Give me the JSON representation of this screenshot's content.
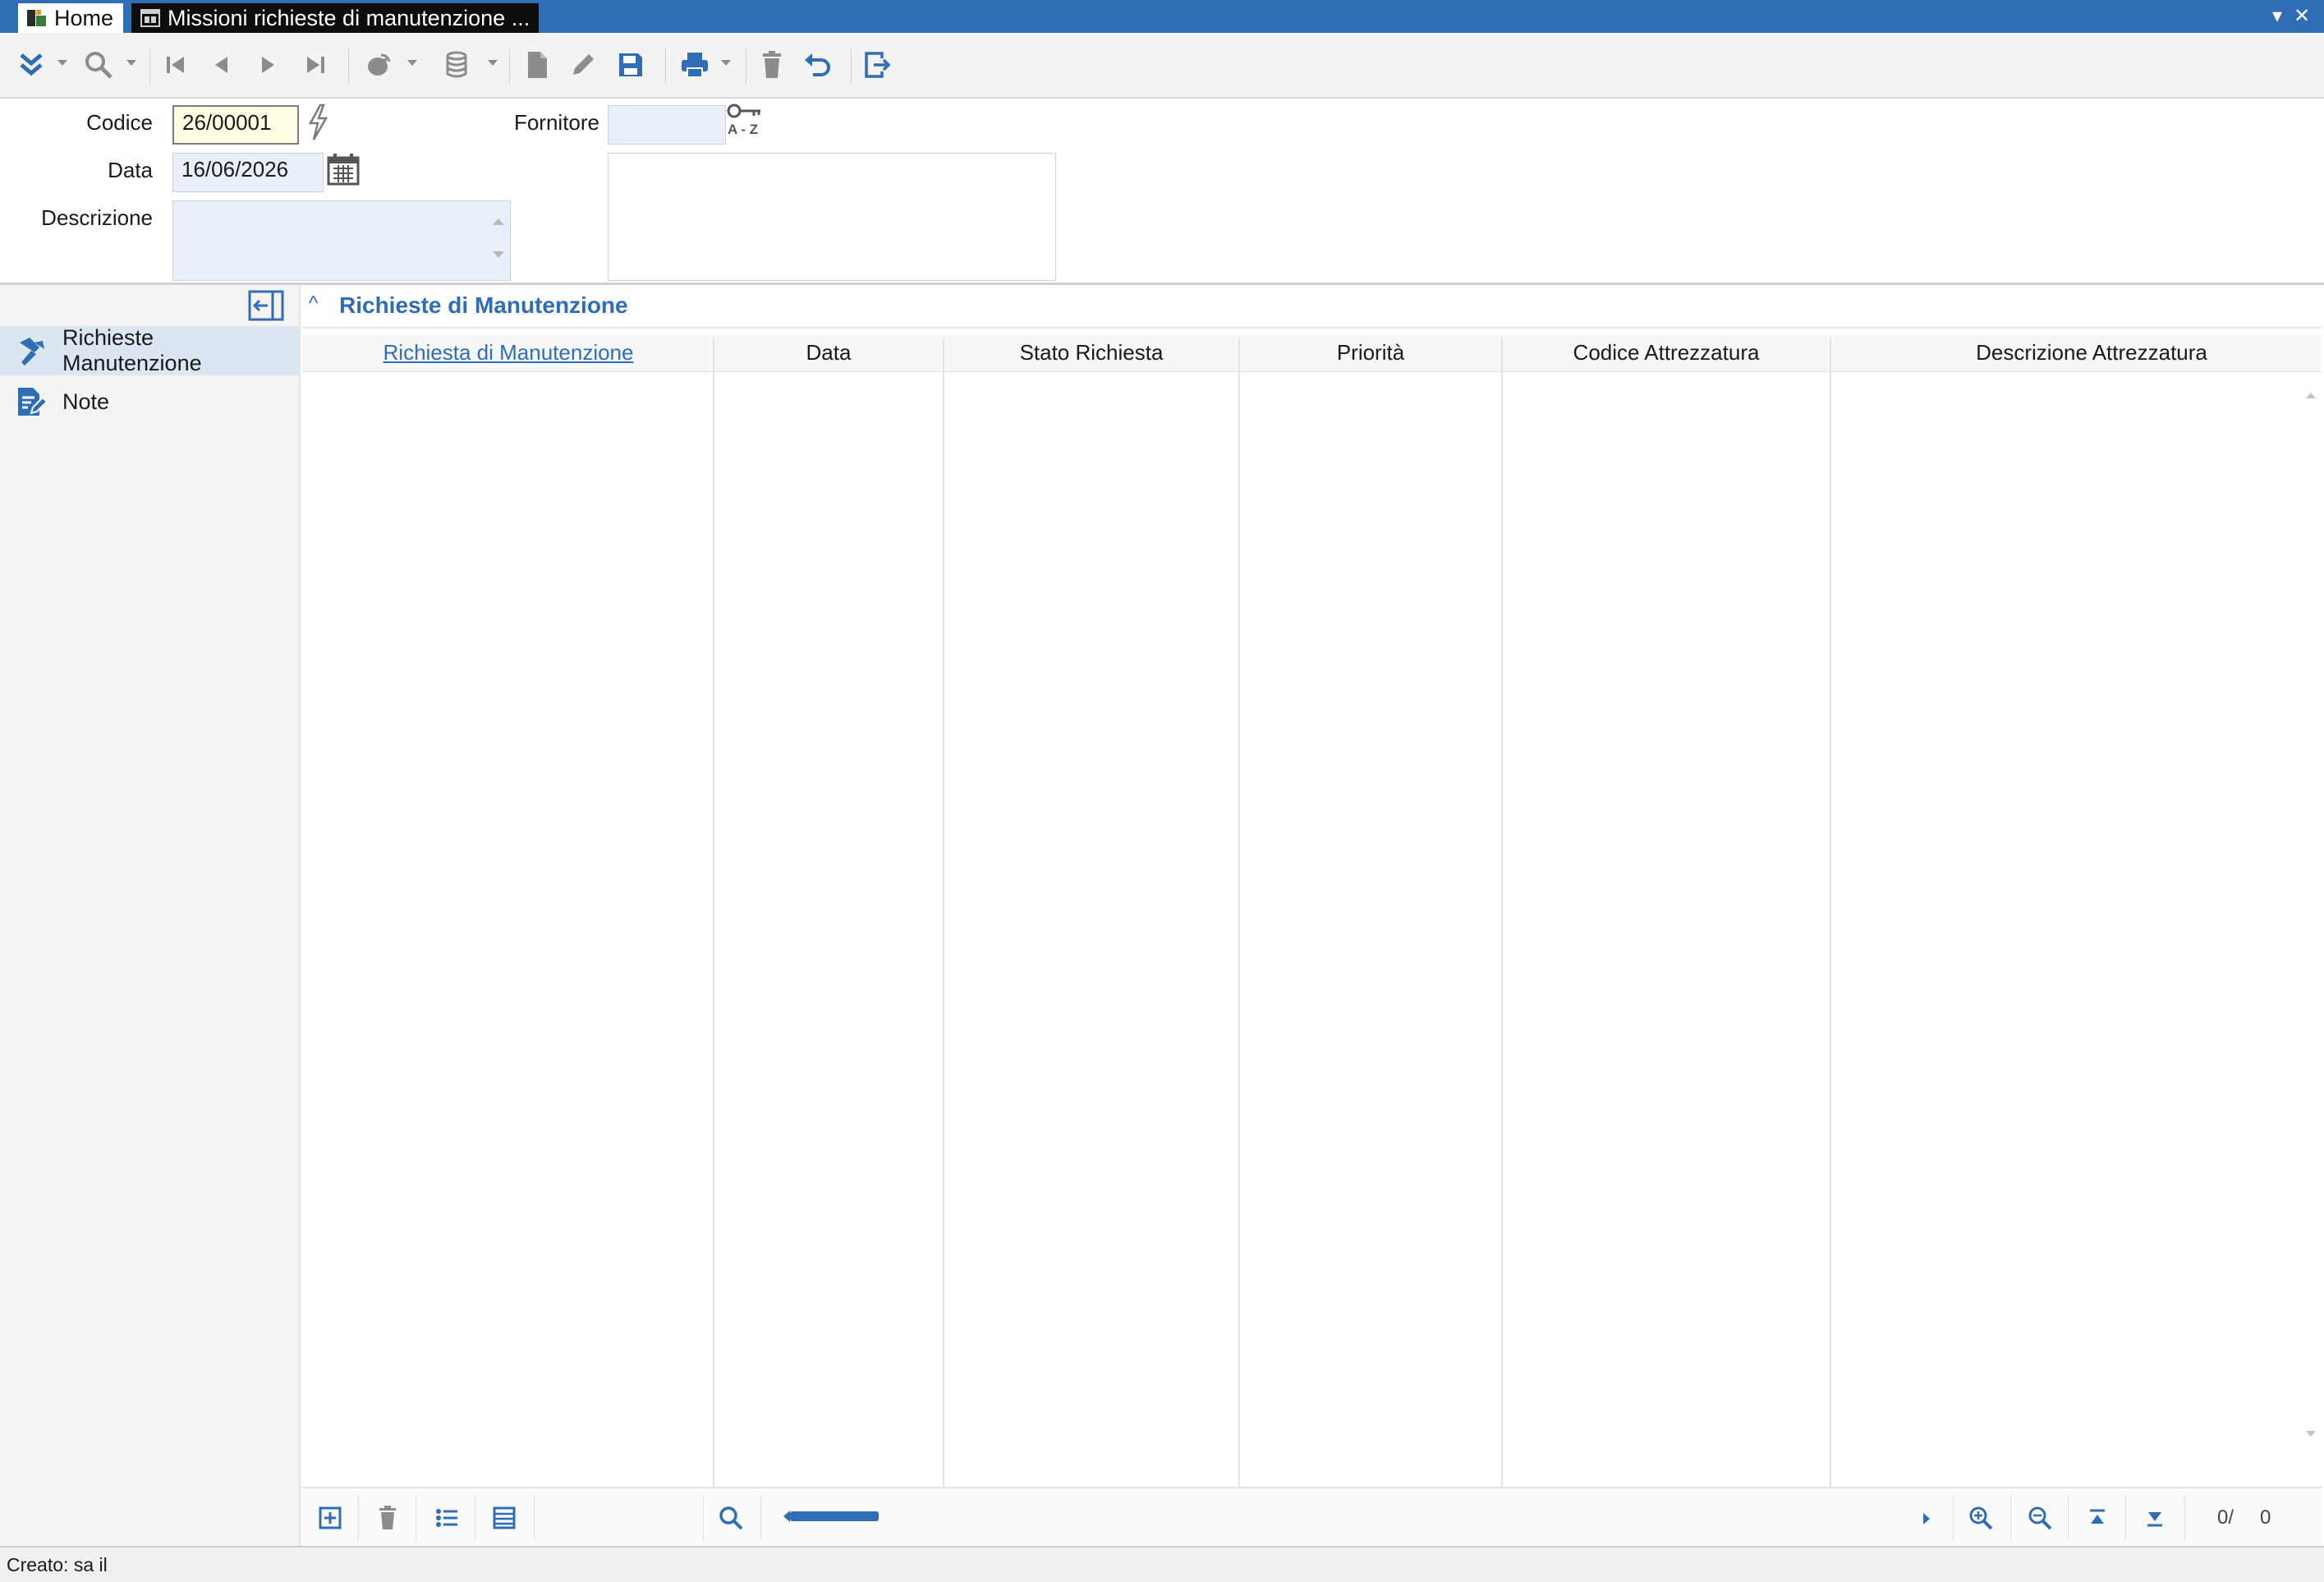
{
  "window": {
    "tabs": [
      {
        "label": "Home"
      },
      {
        "label": "Missioni richieste di manutenzione ..."
      }
    ],
    "controls": {
      "dropdown": "▾",
      "close": "✕"
    }
  },
  "toolbar": {
    "icons": [
      "expand-all-icon",
      "search-icon",
      "first-record-icon",
      "previous-record-icon",
      "next-record-icon",
      "last-record-icon",
      "satellite-icon",
      "database-icon",
      "new-document-icon",
      "edit-icon",
      "save-icon",
      "print-icon",
      "delete-icon",
      "undo-icon",
      "exit-icon"
    ]
  },
  "form": {
    "codice": {
      "label": "Codice",
      "value": "26/00001"
    },
    "data": {
      "label": "Data",
      "value": "16/06/2026"
    },
    "descrizione": {
      "label": "Descrizione",
      "value": ""
    },
    "fornitore": {
      "label": "Fornitore",
      "value": ""
    },
    "az_label": "A - Z"
  },
  "sidebar": {
    "items": [
      {
        "label": "Richieste Manutenzione",
        "selected": true,
        "icon": "hammer-icon"
      },
      {
        "label": "Note",
        "selected": false,
        "icon": "note-edit-icon"
      }
    ]
  },
  "section": {
    "caret": "^",
    "title": "Richieste di Manutenzione"
  },
  "grid": {
    "columns": [
      "Richiesta di Manutenzione",
      "Data",
      "Stato Richiesta",
      "Priorità",
      "Codice Attrezzatura",
      "Descrizione Attrezzatura"
    ],
    "rows": [],
    "counter_current": "0/",
    "counter_total": "0"
  },
  "status": {
    "text": "Creato: sa il"
  },
  "colors": {
    "accent": "#2f6db5",
    "title_bar": "#2f6db5",
    "field_bg": "#e9f0f9",
    "current_field_bg": "#fffde3"
  }
}
